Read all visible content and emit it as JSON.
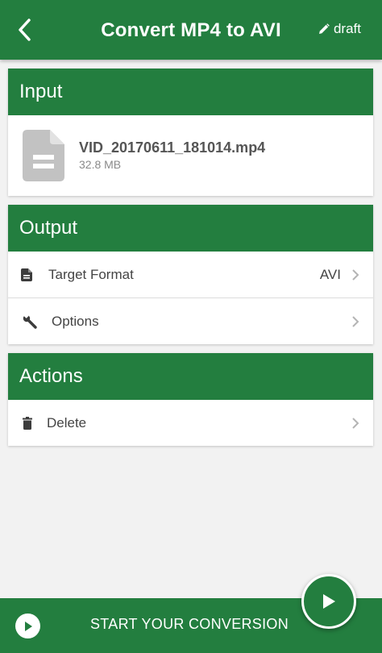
{
  "app_bar": {
    "title": "Convert MP4 to AVI",
    "draft_label": "draft",
    "back_icon": "chevron-left-icon",
    "draft_icon": "pencil-icon"
  },
  "input_card": {
    "header": "Input",
    "file": {
      "name": "VID_20170611_181014.mp4",
      "size": "32.8 MB",
      "icon": "document-icon"
    }
  },
  "output_card": {
    "header": "Output",
    "rows": [
      {
        "label": "Target Format",
        "value": "AVI",
        "icon": "file-icon"
      },
      {
        "label": "Options",
        "value": "",
        "icon": "wrench-icon"
      }
    ]
  },
  "actions_card": {
    "header": "Actions",
    "rows": [
      {
        "label": "Delete",
        "icon": "trash-icon"
      }
    ]
  },
  "bottom_bar": {
    "label": "START YOUR CONVERSION",
    "icon": "play-circle-icon"
  },
  "fab": {
    "icon": "play-icon"
  },
  "colors": {
    "primary": "#237e3f",
    "background": "#f2f2f2",
    "card": "#ffffff",
    "text": "#444444",
    "muted": "#8a8a8a",
    "chevron": "#b4b4b4"
  }
}
